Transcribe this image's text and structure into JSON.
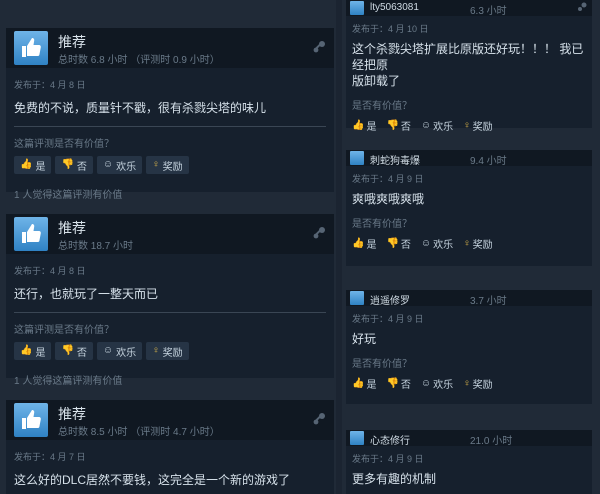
{
  "left_reviews": [
    {
      "title": "推荐",
      "hours": "总时数 6.8 小时 （评测时 0.9 小时）",
      "posted": "发布于：4 月 8 日",
      "text": "免费的不说，质量针不戳，很有杀戮尖塔的味儿",
      "helpful_question": "这篇评测是否有价值？",
      "buttons": [
        "是",
        "否",
        "欢乐",
        "奖励"
      ],
      "helpful_count": "1 人觉得这篇评测有价值"
    },
    {
      "title": "推荐",
      "hours": "总时数 18.7 小时",
      "posted": "发布于：4 月 8 日",
      "text": "还行，也就玩了一整天而已",
      "helpful_question": "这篇评测是否有价值？",
      "buttons": [
        "是",
        "否",
        "欢乐",
        "奖励"
      ],
      "helpful_count": "1 人觉得这篇评测有价值"
    },
    {
      "title": "推荐",
      "hours": "总时数 8.5 小时 （评测时 4.7 小时）",
      "posted": "发布于：4 月 7 日",
      "text": "这么好的DLC居然不要钱，这完全是一个新的游戏了"
    }
  ],
  "right_reviews": [
    {
      "name": "lty5063081",
      "hours": "6.3 小时",
      "posted": "发布于：4 月 10 日",
      "text_lines": [
        "这个杀戮尖塔扩展比原版还好玩！！！ 我已经把原",
        "版卸载了"
      ],
      "helpful_question": "是否有价值？",
      "buttons": [
        "是",
        "否",
        "欢乐",
        "奖励"
      ]
    },
    {
      "name": "刺蛇狗毒爆",
      "hours": "9.4 小时",
      "posted": "发布于：4 月 9 日",
      "text_lines": [
        "爽哦爽哦爽哦"
      ],
      "helpful_question": "是否有价值？",
      "buttons": [
        "是",
        "否",
        "欢乐",
        "奖励"
      ]
    },
    {
      "name": "逍遥修罗",
      "hours": "3.7 小时",
      "posted": "发布于：4 月 9 日",
      "text_lines": [
        "好玩"
      ],
      "helpful_question": "是否有价值？",
      "buttons": [
        "是",
        "否",
        "欢乐",
        "奖励"
      ]
    },
    {
      "name": "心态修行",
      "hours": "21.0 小时",
      "posted": "发布于：4 月 9 日",
      "text_lines": [
        "更多有趣的机制"
      ]
    }
  ]
}
